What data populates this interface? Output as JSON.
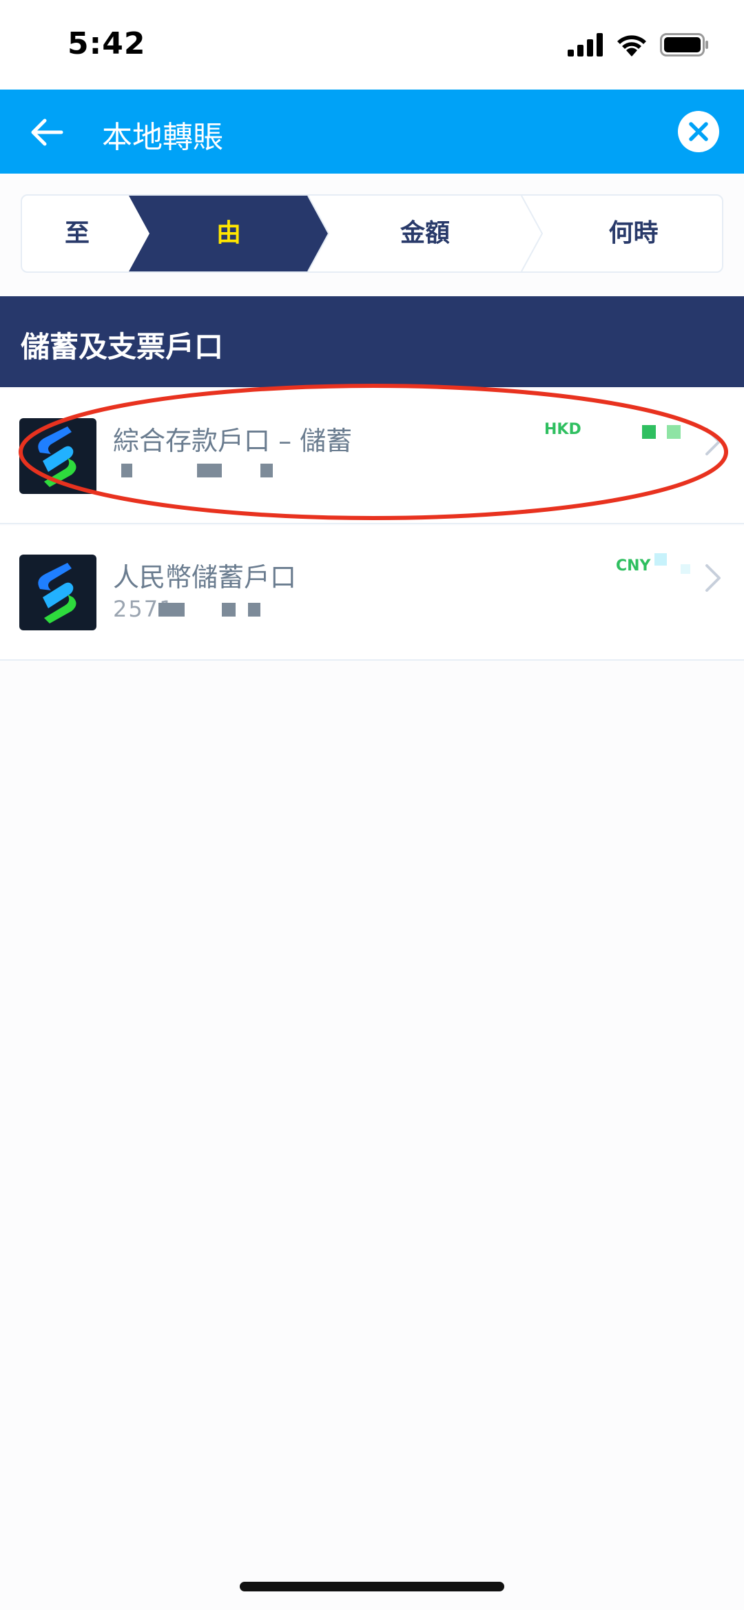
{
  "status_bar": {
    "time": "5:42",
    "icons": [
      "signal-icon",
      "wifi-icon",
      "battery-icon"
    ]
  },
  "header": {
    "title": "本地轉賬",
    "back_icon": "arrow-left-icon",
    "close_icon": "close-icon",
    "background_color": "#00a2f7"
  },
  "steps": [
    {
      "label": "至",
      "active": false
    },
    {
      "label": "由",
      "active": true
    },
    {
      "label": "金額",
      "active": false
    },
    {
      "label": "何時",
      "active": false
    }
  ],
  "section": {
    "title": "儲蓄及支票戶口",
    "background_color": "#27386b"
  },
  "accounts": [
    {
      "name": "綜合存款戶口 – 儲蓄",
      "number": "",
      "currency": "HKD",
      "highlighted": true
    },
    {
      "name": "人民幣儲蓄戶口",
      "number": "2571",
      "currency": "CNY",
      "highlighted": false
    }
  ],
  "colors": {
    "accent": "#00a2f7",
    "navy": "#27386b",
    "active_step_text": "#ffe600",
    "currency_green": "#2fbf60",
    "highlight_red": "#e8321f"
  }
}
